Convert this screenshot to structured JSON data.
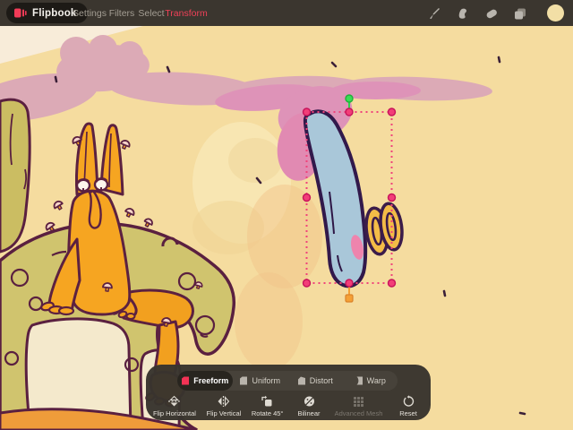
{
  "titlebar": {
    "app_button": {
      "label": "Flipbook",
      "icon": "flipbook-logo-icon",
      "accent_color": "#f23b57"
    },
    "menus": [
      {
        "label": "Settings",
        "active": false
      },
      {
        "label": "Filters",
        "active": false
      },
      {
        "label": "Select",
        "active": false
      },
      {
        "label": "Transform",
        "active": true,
        "active_color": "#ef4158"
      }
    ],
    "tools": [
      {
        "name": "brush-icon"
      },
      {
        "name": "smudge-icon"
      },
      {
        "name": "eraser-icon"
      },
      {
        "name": "layers-icon"
      },
      {
        "name": "color-swatch",
        "color": "#f2dfa6"
      }
    ]
  },
  "transform_toolbar": {
    "modes": [
      {
        "label": "Freeform",
        "selected": true,
        "icon_color": "#f23355"
      },
      {
        "label": "Uniform",
        "selected": false
      },
      {
        "label": "Distort",
        "selected": false
      },
      {
        "label": "Warp",
        "selected": false
      }
    ],
    "actions": [
      {
        "label": "Flip Horizontal",
        "disabled": false
      },
      {
        "label": "Flip Vertical",
        "disabled": false
      },
      {
        "label": "Rotate 45°",
        "disabled": false
      },
      {
        "label": "Bilinear",
        "disabled": false
      },
      {
        "label": "Advanced Mesh",
        "disabled": true
      },
      {
        "label": "Reset",
        "disabled": false
      }
    ]
  },
  "canvas": {
    "background_color": "#f5dc9f",
    "selection": {
      "border_color": "#f0437b",
      "handle_color": "#f23e78",
      "rotate_handle_color": "#39dd55",
      "pivot_handle_color": "#f5a035"
    },
    "artwork_palette": {
      "smoke_pink": "#dcaab6",
      "bright_pink": "#de93b8",
      "creature_yellow": "#f6a521",
      "mound_green": "#d0c46e",
      "belly_cream": "#f4e9cc",
      "ground_orange": "#ef9c3a",
      "selected_object_blue": "#a9c7d9",
      "ring_yellow": "#f3bc47",
      "outline_maroon": "#5a2040"
    }
  }
}
